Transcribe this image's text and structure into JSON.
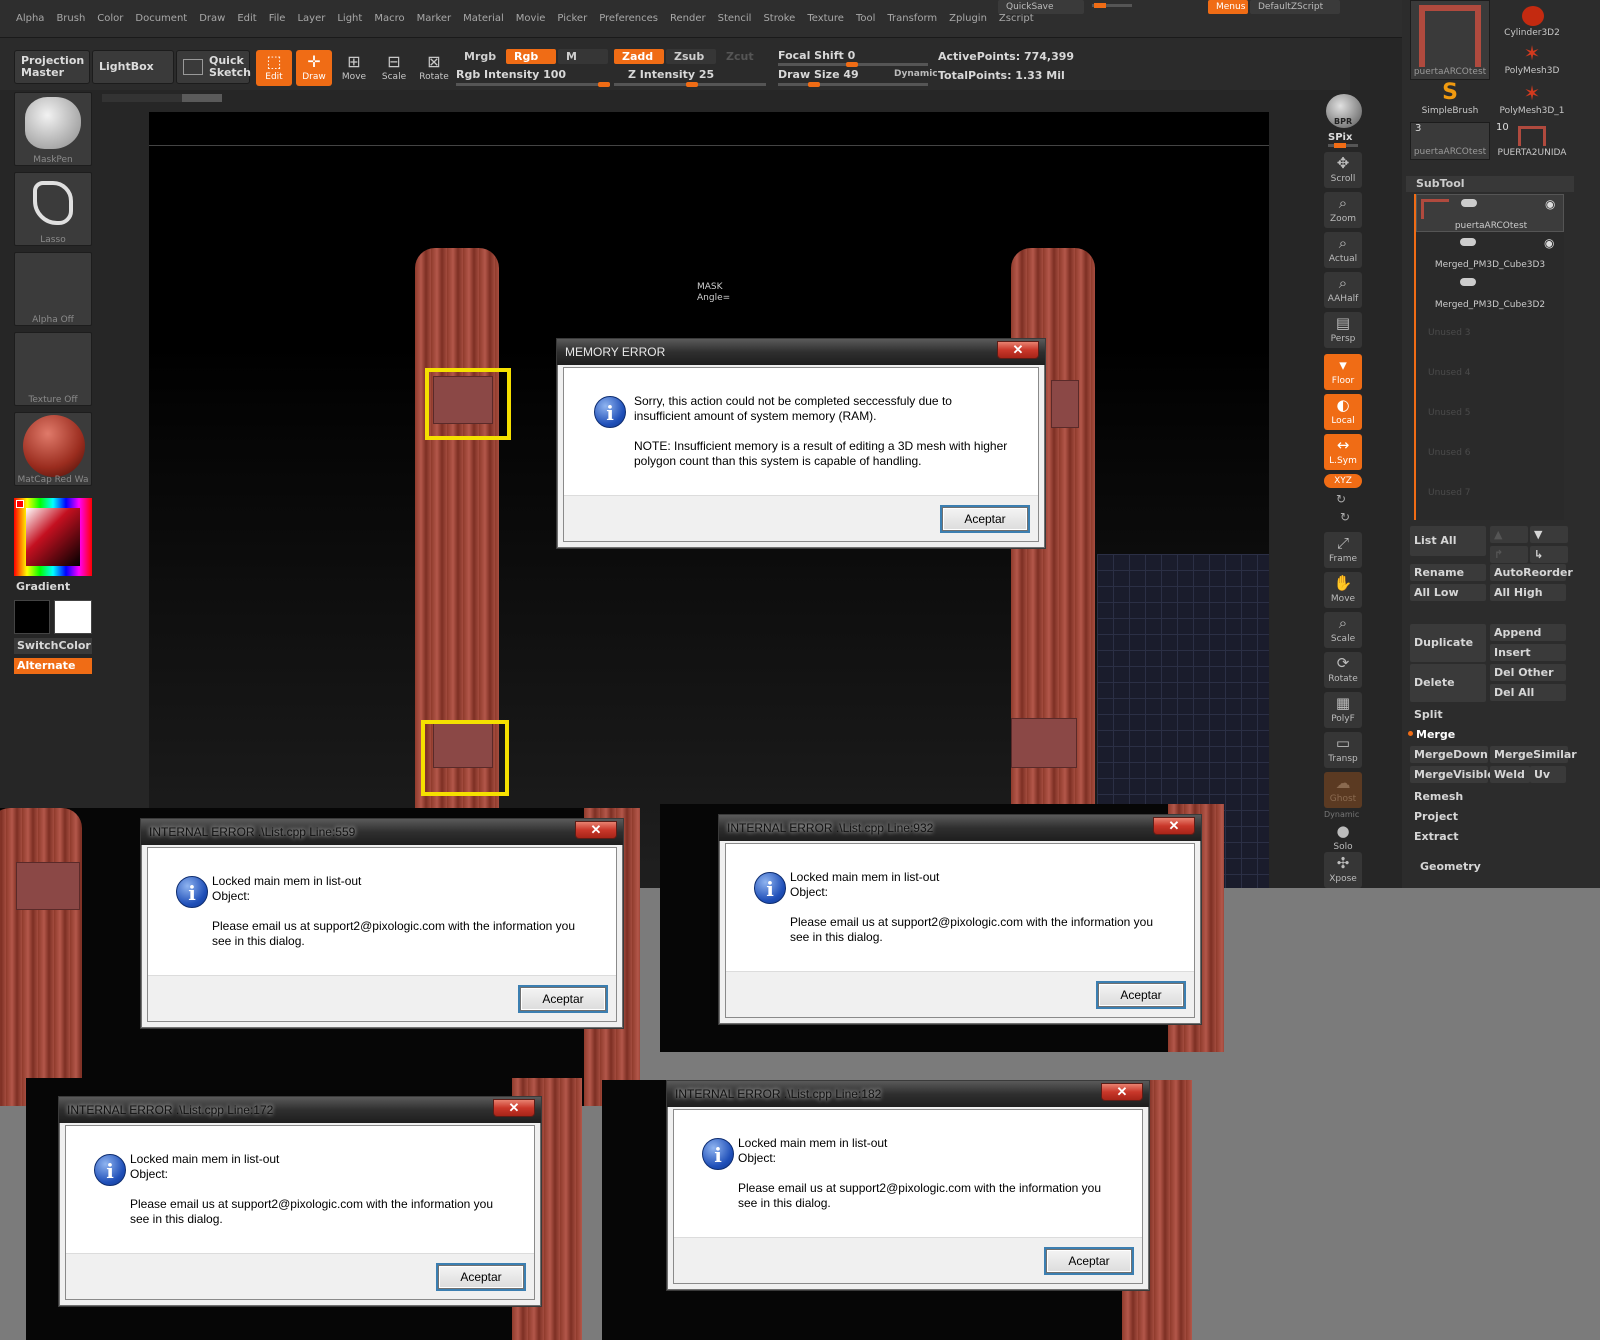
{
  "menu": {
    "items": [
      "Alpha",
      "Brush",
      "Color",
      "Document",
      "Draw",
      "Edit",
      "File",
      "Layer",
      "Light",
      "Macro",
      "Marker",
      "Material",
      "Movie",
      "Picker",
      "Preferences",
      "Render",
      "Stencil",
      "Stroke",
      "Texture",
      "Tool",
      "Transform",
      "Zplugin",
      "Zscript"
    ],
    "quicksave": "QuickSave",
    "menus_btn": "Menus",
    "script": "DefaultZScript"
  },
  "toolbar": {
    "projection_master": "Projection Master",
    "lightbox": "LightBox",
    "quick_sketch": "Quick Sketch",
    "edit": "Edit",
    "draw": "Draw",
    "move": "Move",
    "scale": "Scale",
    "rotate": "Rotate",
    "mrgb": "Mrgb",
    "rgb": "Rgb",
    "m": "M",
    "rgb_intensity": "Rgb Intensity 100",
    "zadd": "Zadd",
    "zsub": "Zsub",
    "zcut": "Zcut",
    "z_intensity": "Z Intensity 25",
    "focal_shift": "Focal Shift 0",
    "draw_size": "Draw Size 49",
    "dynamic": "Dynamic",
    "active_points": "ActivePoints: 774,399",
    "total_points": "TotalPoints: 1.33 Mil"
  },
  "left_shelf": {
    "brush": "MaskPen",
    "stroke": "Lasso",
    "alpha": "Alpha Off",
    "texture": "Texture Off",
    "material": "MatCap Red Wa",
    "gradient": "Gradient",
    "switch_color": "SwitchColor",
    "alternate": "Alternate"
  },
  "canvas": {
    "mask_label": "MASK",
    "angle_label": "Angle="
  },
  "right_shelf": {
    "tools": [
      "BPR",
      "SPix",
      "Scroll",
      "Zoom",
      "Actual",
      "AAHalf",
      "Persp",
      "Floor",
      "Local",
      "L.Sym",
      "XYZ",
      "Frame",
      "Move",
      "Scale",
      "Rotate",
      "PolyF",
      "Transp",
      "Ghost",
      "Dynamic",
      "Solo",
      "Xpose"
    ]
  },
  "tray": {
    "tool_thumbs": [
      "puertaARCOtest",
      "Cylinder3D2",
      "PolyMesh3D",
      "SimpleBrush",
      "PolyMesh3D_1",
      "puertaARCOtest",
      "PUERTA2UNIDA"
    ],
    "thumb_count_a": "3",
    "thumb_count_b": "10",
    "subtool_header": "SubTool",
    "subtools": [
      "puertaARCOtest",
      "Merged_PM3D_Cube3D3",
      "Merged_PM3D_Cube3D2"
    ],
    "unused": [
      "Unused 3",
      "Unused 4",
      "Unused 5",
      "Unused 6",
      "Unused 7"
    ],
    "list_all": "List All",
    "rename": "Rename",
    "auto_reorder": "AutoReorder",
    "all_low": "All Low",
    "all_high": "All High",
    "duplicate": "Duplicate",
    "append": "Append",
    "insert": "Insert",
    "delete": "Delete",
    "del_other": "Del Other",
    "del_all": "Del All",
    "split": "Split",
    "merge": "Merge",
    "merge_down": "MergeDown",
    "merge_similar": "MergeSimilar",
    "merge_visible": "MergeVisible",
    "weld": "Weld",
    "uv": "Uv",
    "remesh": "Remesh",
    "project": "Project",
    "extract": "Extract",
    "geometry": "Geometry"
  },
  "dialogs": {
    "memory": {
      "title": "MEMORY ERROR",
      "line1": "Sorry, this action could not be completed seccessfuly due to",
      "line2": "insufficient amount of system memory (RAM).",
      "line3": "NOTE: Insufficient memory is a result of editing a 3D mesh with higher",
      "line4": "polygon count than this system is capable of handling.",
      "ok": "Aceptar"
    },
    "internal": [
      {
        "title": "INTERNAL ERROR .\\List.cpp  Line:559"
      },
      {
        "title": "INTERNAL ERROR .\\List.cpp  Line:932"
      },
      {
        "title": "INTERNAL ERROR .\\List.cpp  Line:172"
      },
      {
        "title": "INTERNAL ERROR .\\List.cpp  Line:182"
      }
    ],
    "internal_line1": "Locked main mem in list-out",
    "internal_line2": "Object:",
    "internal_line3": "Please email us at support2@pixologic.com with the information you",
    "internal_line4": "see in this dialog.",
    "ok": "Aceptar",
    "close": "✕",
    "info_glyph": "i"
  }
}
